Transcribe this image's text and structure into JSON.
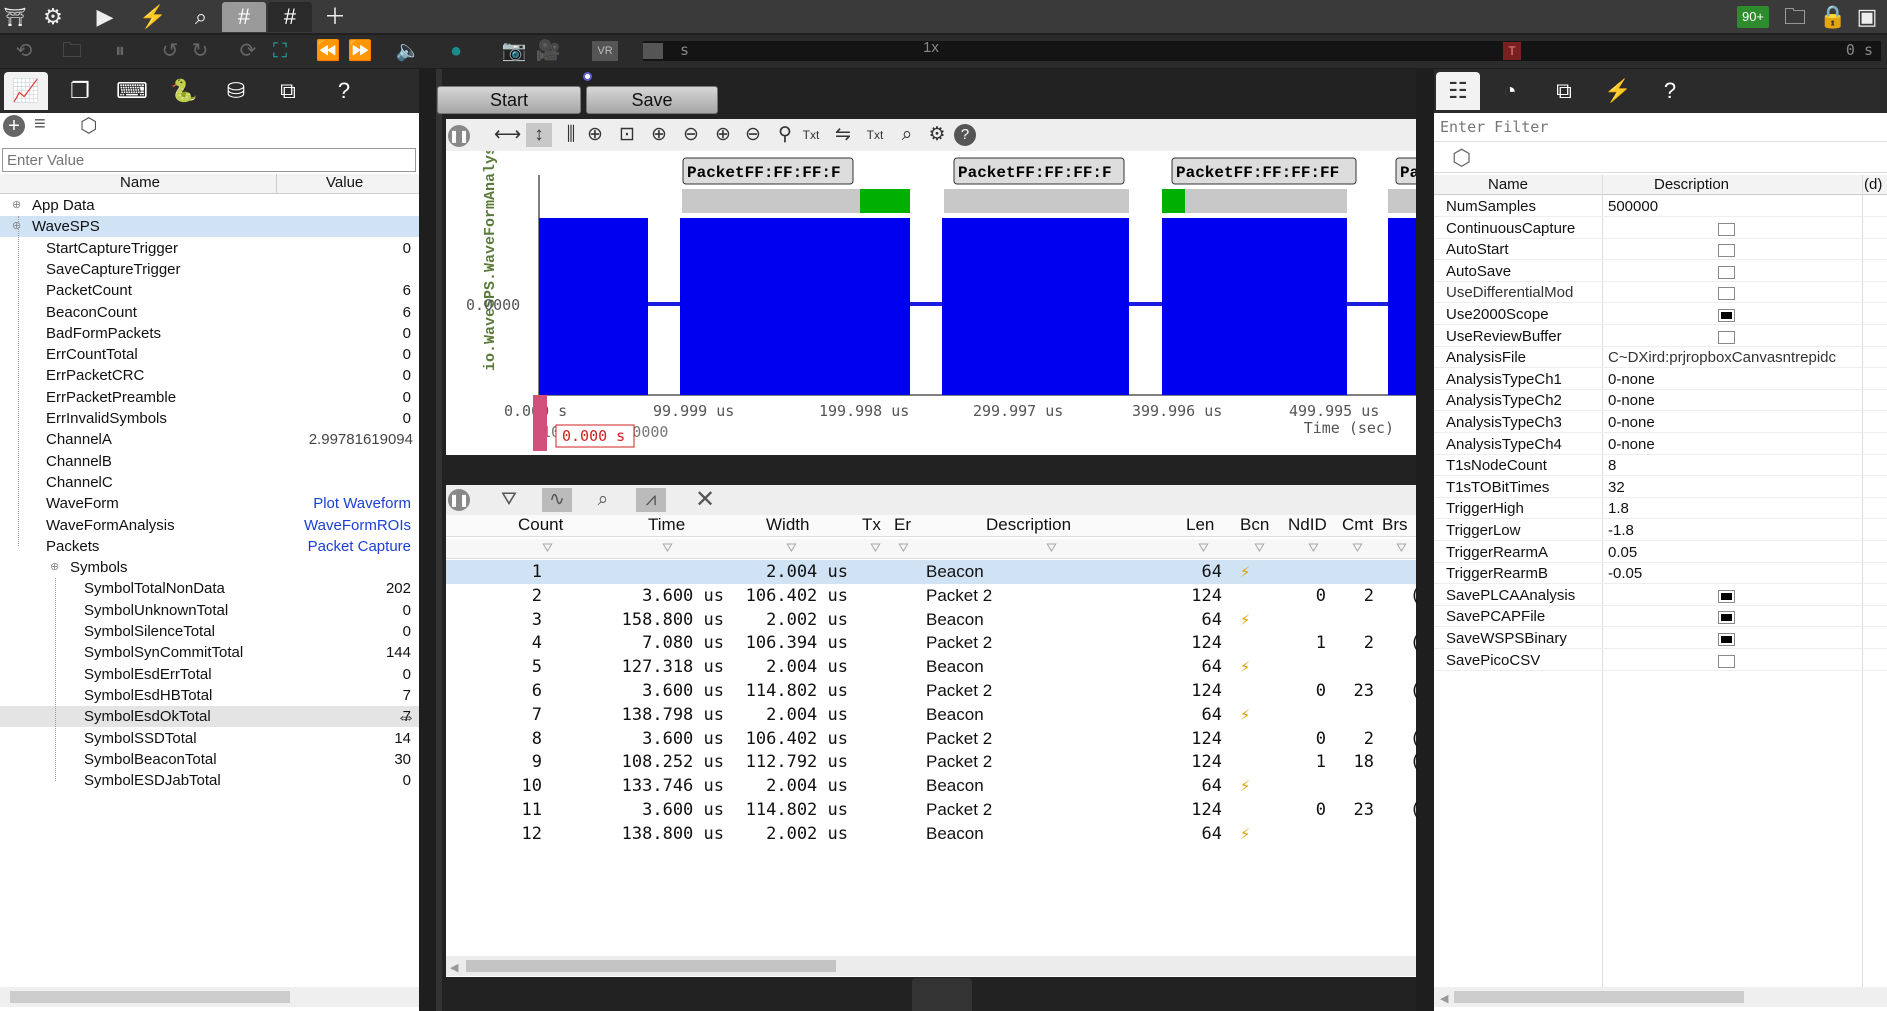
{
  "topbar": {
    "tabs": [
      "#",
      "#"
    ],
    "fps_badge": "90+"
  },
  "secbar": {
    "timeline_left": "s",
    "timeline_speed": "1x",
    "timeline_right": "0 s",
    "marker": "T",
    "vr_label": "VR"
  },
  "left": {
    "filter_placeholder": "Enter Value",
    "col_name": "Name",
    "col_value": "Value",
    "rows": [
      {
        "name": "App Data",
        "value": ""
      },
      {
        "name": "WaveSPS",
        "value": ""
      },
      {
        "name": "StartCaptureTrigger",
        "value": "0"
      },
      {
        "name": "SaveCaptureTrigger",
        "value": ""
      },
      {
        "name": "PacketCount",
        "value": "6"
      },
      {
        "name": "BeaconCount",
        "value": "6"
      },
      {
        "name": "BadFormPackets",
        "value": "0"
      },
      {
        "name": "ErrCountTotal",
        "value": "0"
      },
      {
        "name": "ErrPacketCRC",
        "value": "0"
      },
      {
        "name": "ErrPacketPreamble",
        "value": "0"
      },
      {
        "name": "ErrInvalidSymbols",
        "value": "0"
      },
      {
        "name": "ChannelA",
        "value": "2.99781619094"
      },
      {
        "name": "ChannelB",
        "value": ""
      },
      {
        "name": "ChannelC",
        "value": ""
      },
      {
        "name": "WaveForm",
        "value": "Plot Waveform"
      },
      {
        "name": "WaveFormAnalysis",
        "value": "WaveFormROIs"
      },
      {
        "name": "Packets",
        "value": "Packet Capture"
      },
      {
        "name": "Symbols",
        "value": ""
      },
      {
        "name": "SymbolTotalNonData",
        "value": "202"
      },
      {
        "name": "SymbolUnknownTotal",
        "value": "0"
      },
      {
        "name": "SymbolSilenceTotal",
        "value": "0"
      },
      {
        "name": "SymbolSynCommitTotal",
        "value": "144"
      },
      {
        "name": "SymbolEsdErrTotal",
        "value": "0"
      },
      {
        "name": "SymbolEsdHBTotal",
        "value": "7"
      },
      {
        "name": "SymbolEsdOkTotal",
        "value": "7"
      },
      {
        "name": "SymbolSSDTotal",
        "value": "14"
      },
      {
        "name": "SymbolBeaconTotal",
        "value": "30"
      },
      {
        "name": "SymbolESDJabTotal",
        "value": "0"
      }
    ]
  },
  "center": {
    "start_label": "Start",
    "save_label": "Save",
    "waveform": {
      "ylabel": "io.WaveSPS.WaveFormAnalysis",
      "ytick": "0.0000",
      "xticks": [
        "0.000 s",
        "99.999 us",
        "199.998 us",
        "299.997 us",
        "399.996 us",
        "499.995 us"
      ],
      "xlabel": "Time (sec)",
      "cursor_value": "0.000 s",
      "cursor_bg_text": "10.00000000000",
      "packet_labels": [
        "PacketFF:FF:FF:F",
        "PacketFF:FF:FF:F",
        "PacketFF:FF:FF:FF",
        "Pa"
      ],
      "txt_label": "Txt"
    },
    "packets": {
      "headers": [
        "Count",
        "Time",
        "Width",
        "Tx",
        "Er",
        "Description",
        "Len",
        "Bcn",
        "NdID",
        "Cmt",
        "Brs"
      ],
      "rows": [
        {
          "count": "1",
          "time": "",
          "width": "2.004 us",
          "desc": "Beacon",
          "len": "64",
          "bcn": true,
          "ndid": "",
          "cmt": ""
        },
        {
          "count": "2",
          "time": "3.600 us",
          "width": "106.402 us",
          "desc": "Packet 2",
          "len": "124",
          "bcn": false,
          "ndid": "0",
          "cmt": "2"
        },
        {
          "count": "3",
          "time": "158.800 us",
          "width": "2.002 us",
          "desc": "Beacon",
          "len": "64",
          "bcn": true,
          "ndid": "",
          "cmt": ""
        },
        {
          "count": "4",
          "time": "7.080 us",
          "width": "106.394 us",
          "desc": "Packet 2",
          "len": "124",
          "bcn": false,
          "ndid": "1",
          "cmt": "2"
        },
        {
          "count": "5",
          "time": "127.318 us",
          "width": "2.004 us",
          "desc": "Beacon",
          "len": "64",
          "bcn": true,
          "ndid": "",
          "cmt": ""
        },
        {
          "count": "6",
          "time": "3.600 us",
          "width": "114.802 us",
          "desc": "Packet 2",
          "len": "124",
          "bcn": false,
          "ndid": "0",
          "cmt": "23"
        },
        {
          "count": "7",
          "time": "138.798 us",
          "width": "2.004 us",
          "desc": "Beacon",
          "len": "64",
          "bcn": true,
          "ndid": "",
          "cmt": ""
        },
        {
          "count": "8",
          "time": "3.600 us",
          "width": "106.402 us",
          "desc": "Packet 2",
          "len": "124",
          "bcn": false,
          "ndid": "0",
          "cmt": "2"
        },
        {
          "count": "9",
          "time": "108.252 us",
          "width": "112.792 us",
          "desc": "Packet 2",
          "len": "124",
          "bcn": false,
          "ndid": "1",
          "cmt": "18"
        },
        {
          "count": "10",
          "time": "133.746 us",
          "width": "2.004 us",
          "desc": "Beacon",
          "len": "64",
          "bcn": true,
          "ndid": "",
          "cmt": ""
        },
        {
          "count": "11",
          "time": "3.600 us",
          "width": "114.802 us",
          "desc": "Packet 2",
          "len": "124",
          "bcn": false,
          "ndid": "0",
          "cmt": "23"
        },
        {
          "count": "12",
          "time": "138.800 us",
          "width": "2.002 us",
          "desc": "Beacon",
          "len": "64",
          "bcn": true,
          "ndid": "",
          "cmt": ""
        }
      ]
    }
  },
  "right": {
    "filter_placeholder": "Enter Filter",
    "col_name": "Name",
    "col_desc": "Description",
    "col_extra": "(d)",
    "rows": [
      {
        "name": "NumSamples",
        "value": "500000"
      },
      {
        "name": "ContinuousCapture",
        "check": false
      },
      {
        "name": "AutoStart",
        "check": false
      },
      {
        "name": "AutoSave",
        "check": false
      },
      {
        "name": "UseDifferentialMod",
        "check": false
      },
      {
        "name": "Use2000Scope",
        "check": true
      },
      {
        "name": "UseReviewBuffer",
        "check": false
      },
      {
        "name": "AnalysisFile",
        "value": "C~DXird:prjropboxCanvasntrepidc"
      },
      {
        "name": "AnalysisTypeCh1",
        "value": "0-none"
      },
      {
        "name": "AnalysisTypeCh2",
        "value": "0-none"
      },
      {
        "name": "AnalysisTypeCh3",
        "value": "0-none"
      },
      {
        "name": "AnalysisTypeCh4",
        "value": "0-none"
      },
      {
        "name": "T1sNodeCount",
        "value": "8"
      },
      {
        "name": "T1sTOBitTimes",
        "value": "32"
      },
      {
        "name": "TriggerHigh",
        "value": "1.8"
      },
      {
        "name": "TriggerLow",
        "value": "-1.8"
      },
      {
        "name": "TriggerRearmA",
        "value": "0.05"
      },
      {
        "name": "TriggerRearmB",
        "value": "-0.05"
      },
      {
        "name": "SavePLCAAnalysis",
        "check": true
      },
      {
        "name": "SavePCAPFile",
        "check": true
      },
      {
        "name": "SaveWSPSBinary",
        "check": true
      },
      {
        "name": "SavePicoCSV",
        "check": false
      }
    ]
  },
  "colors": {
    "accent": "#1a3fd6",
    "wave": "#0000ff",
    "green": "#00a000",
    "selection": "#cfe3f5"
  }
}
